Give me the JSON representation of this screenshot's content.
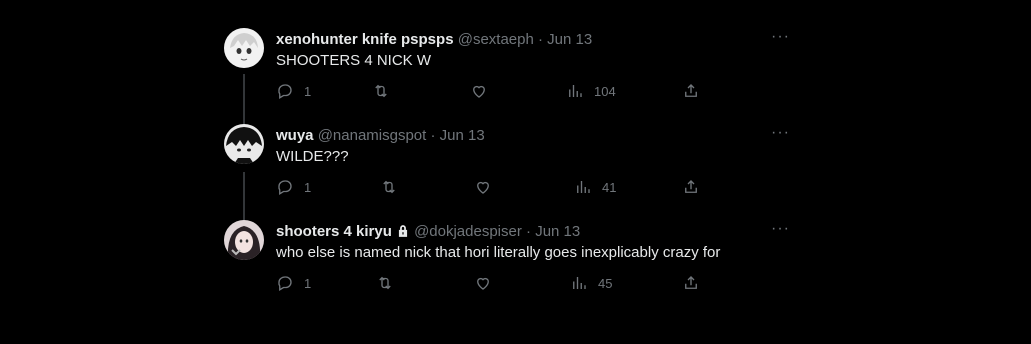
{
  "tweets": [
    {
      "name": "xenohunter knife pspsps",
      "handle": "@sextaeph",
      "dot": "·",
      "date": "Jun 13",
      "text": "SHOOTERS 4 NICK W",
      "replies": "1",
      "retweets": "",
      "likes": "",
      "views": "104",
      "locked": false
    },
    {
      "name": "wuya",
      "handle": "@nanamisgspot",
      "dot": "·",
      "date": "Jun 13",
      "text": "WILDE???",
      "replies": "1",
      "retweets": "",
      "likes": "",
      "views": "41",
      "locked": false
    },
    {
      "name": "shooters 4 kiryu",
      "handle": "@dokjadespiser",
      "dot": "·",
      "date": "Jun 13",
      "text": "who else is named nick that hori literally goes inexplicably crazy for",
      "replies": "1",
      "retweets": "",
      "likes": "",
      "views": "45",
      "locked": true
    }
  ],
  "more_label": "···",
  "icons": [
    "reply-icon",
    "retweet-icon",
    "like-icon",
    "views-icon",
    "share-icon",
    "lock-icon",
    "more-icon"
  ]
}
